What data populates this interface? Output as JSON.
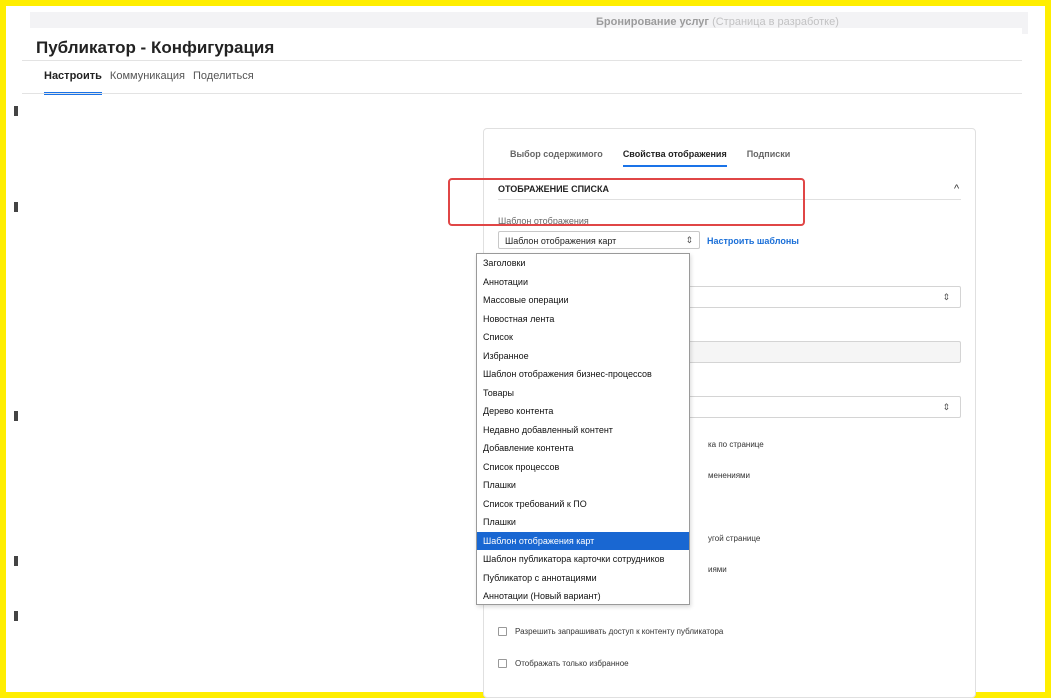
{
  "topbar": {
    "clipped_title": "Бронирование услуг",
    "clipped_note": "(Страница в разработке)"
  },
  "app": {
    "title": "Публикатор - Конфигурация",
    "tabs": [
      {
        "label": "Настроить",
        "active": true
      },
      {
        "label": "Коммуникация",
        "active": false
      },
      {
        "label": "Поделиться",
        "active": false
      }
    ]
  },
  "panel": {
    "subtabs": [
      {
        "label": "Выбор содержимого",
        "active": false
      },
      {
        "label": "Свойства отображения",
        "active": true
      },
      {
        "label": "Подписки",
        "active": false
      }
    ],
    "section_title": "ОТОБРАЖЕНИЕ СПИСКА",
    "caret": "^",
    "template_label": "Шаблон отображения",
    "template_value": "Шаблон отображения карт",
    "select_arrows": "⇕",
    "templates_link": "Настроить шаблоны",
    "partial_texts": {
      "t1": "ка по странице",
      "t2": "менениями",
      "t3": "угой странице",
      "t4": "иями"
    },
    "checkboxes": [
      {
        "label": "Разрешить запрашивать доступ к контенту публикатора"
      },
      {
        "label": "Отображать только избранное"
      }
    ]
  },
  "dropdown": {
    "options": [
      {
        "label": "Заголовки",
        "selected": false
      },
      {
        "label": "Аннотации",
        "selected": false
      },
      {
        "label": "Массовые операции",
        "selected": false
      },
      {
        "label": "Новостная лента",
        "selected": false
      },
      {
        "label": "Список",
        "selected": false
      },
      {
        "label": "Избранное",
        "selected": false
      },
      {
        "label": "Шаблон отображения бизнес-процессов",
        "selected": false
      },
      {
        "label": "Товары",
        "selected": false
      },
      {
        "label": "Дерево контента",
        "selected": false
      },
      {
        "label": "Недавно добавленный контент",
        "selected": false
      },
      {
        "label": "Добавление контента",
        "selected": false
      },
      {
        "label": "Список процессов",
        "selected": false
      },
      {
        "label": "Плашки",
        "selected": false
      },
      {
        "label": "Список требований к ПО",
        "selected": false
      },
      {
        "label": "Плашки",
        "selected": false
      },
      {
        "label": "Шаблон отображения карт",
        "selected": true
      },
      {
        "label": "Шаблон публикатора карточки сотрудников",
        "selected": false
      },
      {
        "label": "Публикатор с аннотациями",
        "selected": false
      },
      {
        "label": "Аннотации (Новый вариант)",
        "selected": false
      }
    ]
  },
  "colors": {
    "frame": "#ffee00",
    "accent": "#1a73e8",
    "selected_option": "#1967d2",
    "highlight_box": "#e04646"
  }
}
